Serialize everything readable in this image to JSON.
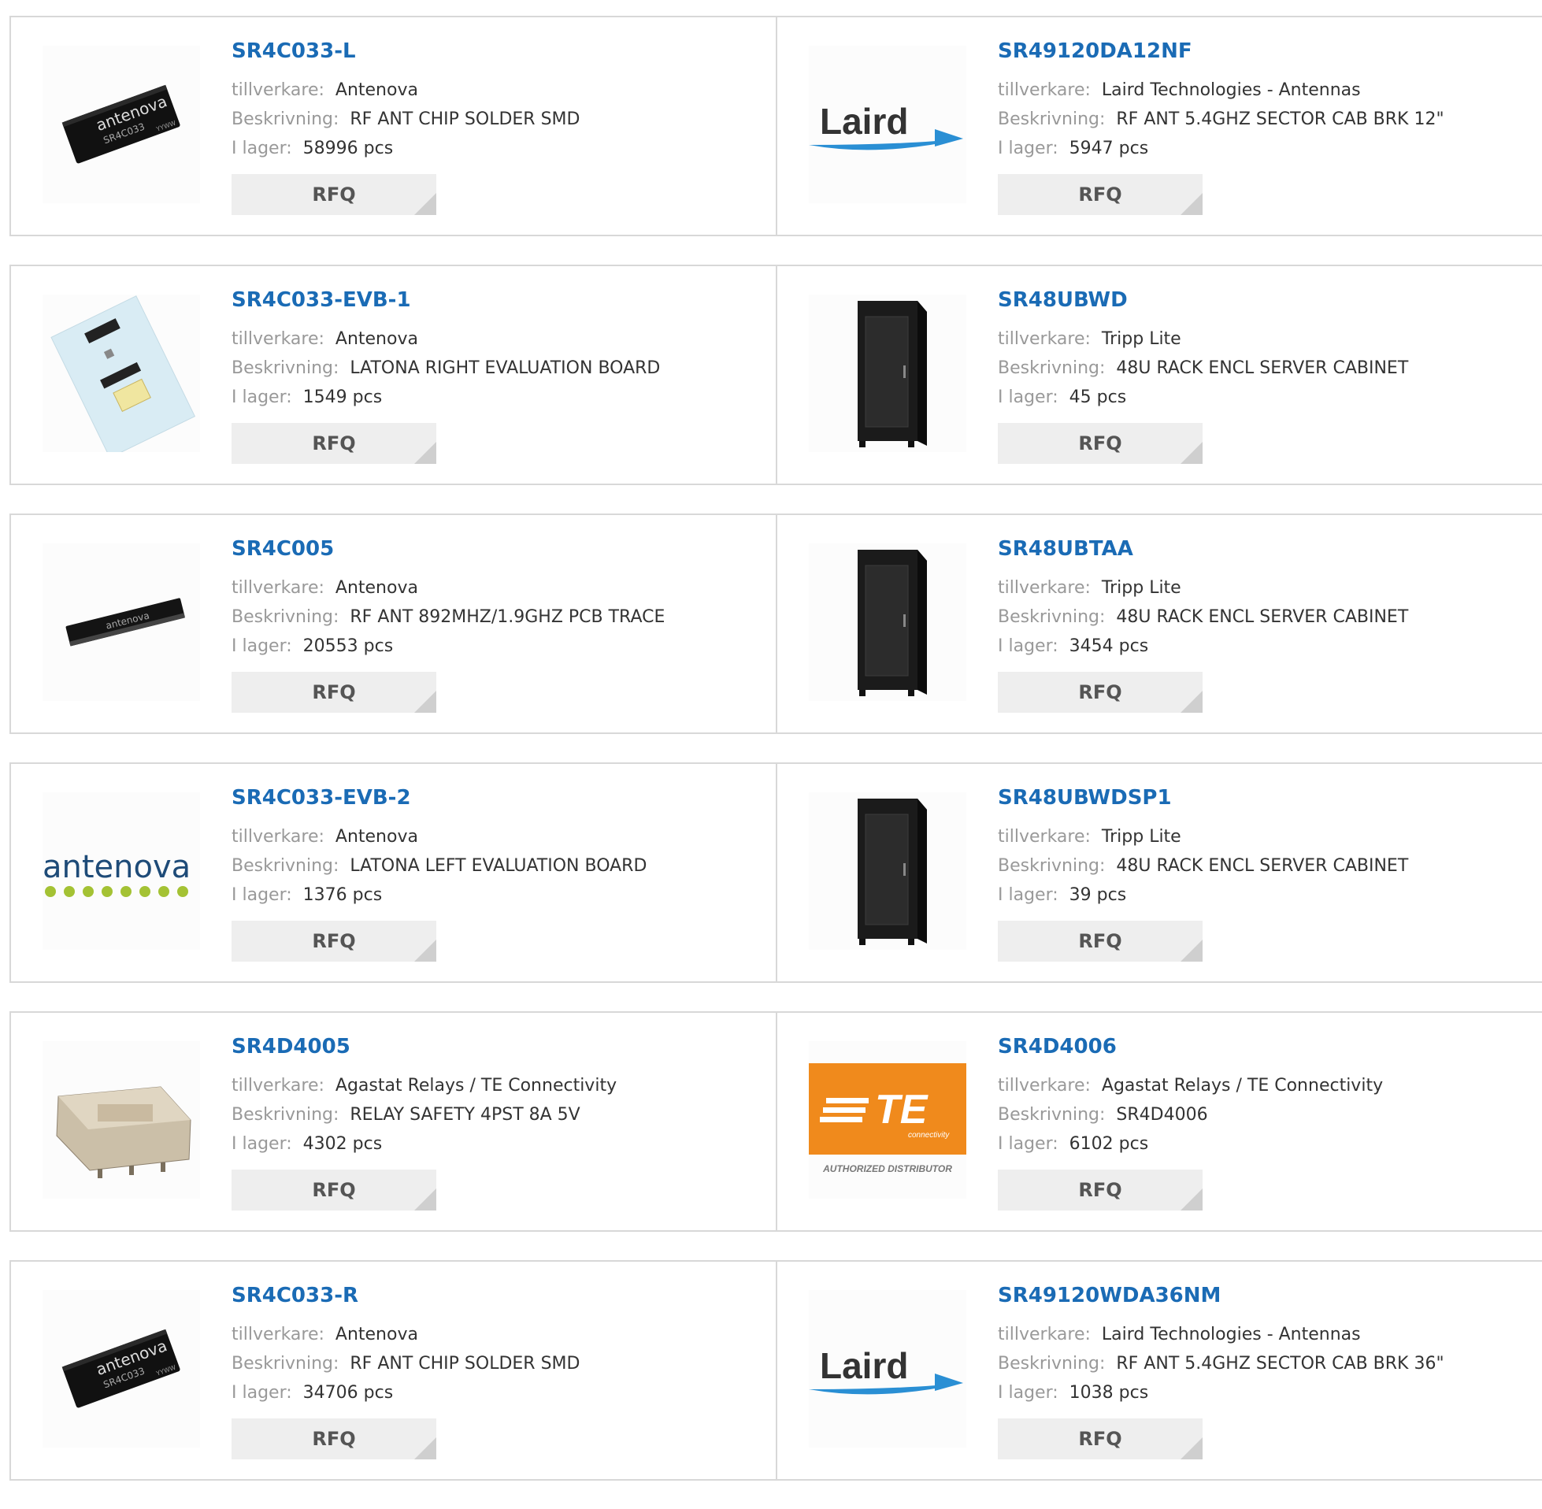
{
  "labels": {
    "manufacturer": "tillverkare:",
    "description": "Beskrivning:",
    "stock": "I lager:",
    "rfq": "RFQ"
  },
  "rows": [
    [
      {
        "pn": "SR4C033-L",
        "manufacturer": "Antenova",
        "description": "RF ANT CHIP SOLDER SMD",
        "stock": "58996 pcs",
        "image": "chip-antenna-image"
      },
      {
        "pn": "SR49120DA12NF",
        "manufacturer": "Laird Technologies - Antennas",
        "description": "RF ANT 5.4GHZ SECTOR CAB BRK 12\"",
        "stock": "5947 pcs",
        "image": "laird-logo",
        "logo_text": "Laird"
      }
    ],
    [
      {
        "pn": "SR4C033-EVB-1",
        "manufacturer": "Antenova",
        "description": "LATONA RIGHT EVALUATION BOARD",
        "stock": "1549 pcs",
        "image": "evaluation-board-image"
      },
      {
        "pn": "SR48UBWD",
        "manufacturer": "Tripp Lite",
        "description": "48U RACK ENCL SERVER CABINET",
        "stock": "45 pcs",
        "image": "server-cabinet-image"
      }
    ],
    [
      {
        "pn": "SR4C005",
        "manufacturer": "Antenova",
        "description": "RF ANT 892MHZ/1.9GHZ PCB TRACE",
        "stock": "20553 pcs",
        "image": "pcb-antenna-image"
      },
      {
        "pn": "SR48UBTAA",
        "manufacturer": "Tripp Lite",
        "description": "48U RACK ENCL SERVER CABINET",
        "stock": "3454 pcs",
        "image": "server-cabinet-image"
      }
    ],
    [
      {
        "pn": "SR4C033-EVB-2",
        "manufacturer": "Antenova",
        "description": "LATONA LEFT EVALUATION BOARD",
        "stock": "1376 pcs",
        "image": "antenova-logo",
        "logo_text": "antenova"
      },
      {
        "pn": "SR48UBWDSP1",
        "manufacturer": "Tripp Lite",
        "description": "48U RACK ENCL SERVER CABINET",
        "stock": "39 pcs",
        "image": "server-cabinet-image"
      }
    ],
    [
      {
        "pn": "SR4D4005",
        "manufacturer": "Agastat Relays / TE Connectivity",
        "description": "RELAY SAFETY 4PST 8A 5V",
        "stock": "4302 pcs",
        "image": "relay-image"
      },
      {
        "pn": "SR4D4006",
        "manufacturer": "Agastat Relays / TE Connectivity",
        "description": "SR4D4006",
        "stock": "6102 pcs",
        "image": "te-logo",
        "logo_text": "TE",
        "logo_sub": "connectivity",
        "logo_caption": "AUTHORIZED DISTRIBUTOR"
      }
    ],
    [
      {
        "pn": "SR4C033-R",
        "manufacturer": "Antenova",
        "description": "RF ANT CHIP SOLDER SMD",
        "stock": "34706 pcs",
        "image": "chip-antenna-image"
      },
      {
        "pn": "SR49120WDA36NM",
        "manufacturer": "Laird Technologies - Antennas",
        "description": "RF ANT 5.4GHZ SECTOR CAB BRK 36\"",
        "stock": "1038 pcs",
        "image": "laird-logo",
        "logo_text": "Laird"
      }
    ]
  ]
}
